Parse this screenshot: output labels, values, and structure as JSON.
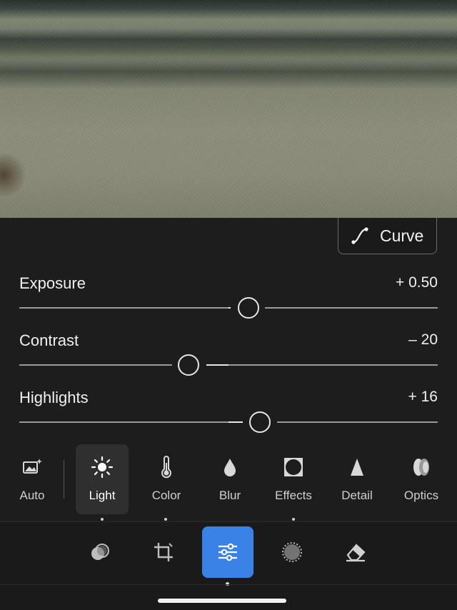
{
  "curve_button": {
    "label": "Curve",
    "icon": "curve-icon"
  },
  "sliders": [
    {
      "label": "Exposure",
      "value": "+ 0.50",
      "level": 0.53
    },
    {
      "label": "Contrast",
      "value": "– 20",
      "level": 0.4
    },
    {
      "label": "Highlights",
      "value": "+ 16",
      "level": 0.58
    }
  ],
  "tools": [
    {
      "label": "Auto",
      "icon": "auto-icon"
    },
    {
      "label": "Light",
      "icon": "sun-icon",
      "active": true
    },
    {
      "label": "Color",
      "icon": "thermometer-icon"
    },
    {
      "label": "Blur",
      "icon": "drop-icon"
    },
    {
      "label": "Effects",
      "icon": "vignette-icon"
    },
    {
      "label": "Detail",
      "icon": "triangle-icon"
    },
    {
      "label": "Optics",
      "icon": "lens-icon"
    }
  ],
  "bottom_toolbar": [
    {
      "icon": "presets-icon"
    },
    {
      "icon": "crop-icon"
    },
    {
      "icon": "adjust-sliders-icon",
      "active": true
    },
    {
      "icon": "masking-icon"
    },
    {
      "icon": "eraser-icon"
    }
  ],
  "colors": {
    "accent": "#3b82e6",
    "panel": "#1d1d1d"
  }
}
